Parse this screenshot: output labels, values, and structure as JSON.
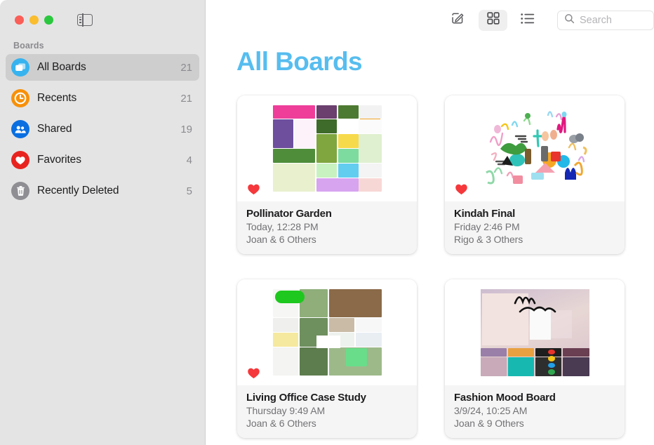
{
  "window": {
    "traffic_lights": [
      "close",
      "minimize",
      "zoom"
    ],
    "sidebar_toggle_icon": "sidebar-toggle-icon"
  },
  "sidebar": {
    "section_label": "Boards",
    "items": [
      {
        "label": "All Boards",
        "count": "21",
        "icon": "boards-icon",
        "color": "#37b3ef",
        "selected": true
      },
      {
        "label": "Recents",
        "count": "21",
        "icon": "clock-icon",
        "color": "#f79009",
        "selected": false
      },
      {
        "label": "Shared",
        "count": "19",
        "icon": "people-icon",
        "color": "#0a6fe0",
        "selected": false
      },
      {
        "label": "Favorites",
        "count": "4",
        "icon": "heart-icon",
        "color": "#e8231f",
        "selected": false
      },
      {
        "label": "Recently Deleted",
        "count": "5",
        "icon": "trash-icon",
        "color": "#8e8e93",
        "selected": false
      }
    ]
  },
  "toolbar": {
    "compose_label": "compose-icon",
    "grid_view_label": "grid-view-icon",
    "list_view_label": "list-view-icon",
    "grid_view_active": true,
    "search_placeholder": "Search",
    "search_value": "",
    "search_icon": "search-icon"
  },
  "main": {
    "title": "All Boards",
    "title_color": "#57bdef",
    "boards": [
      {
        "title": "Pollinator Garden",
        "date": "Today, 12:28 PM",
        "people": "Joan & 6 Others",
        "favorite": true,
        "thumb": "pollinator-garden-collage"
      },
      {
        "title": "Kindah Final",
        "date": "Friday 2:46 PM",
        "people": "Rigo & 3 Others",
        "favorite": true,
        "thumb": "kindah-final-doodles"
      },
      {
        "title": "Living Office Case Study",
        "date": "Thursday 9:49 AM",
        "people": "Joan & 6 Others",
        "favorite": true,
        "thumb": "living-office-collage"
      },
      {
        "title": "Fashion Mood Board",
        "date": "3/9/24, 10:25 AM",
        "people": "Joan & 9 Others",
        "favorite": true,
        "thumb": "fashion-mood-collage"
      }
    ]
  }
}
